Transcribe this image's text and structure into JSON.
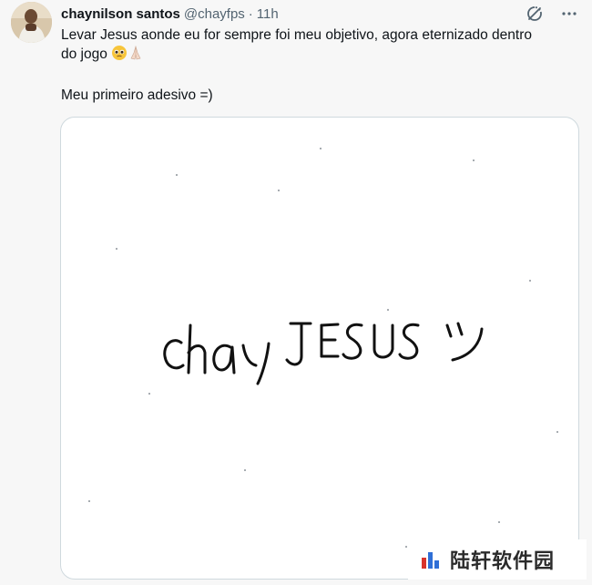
{
  "author": {
    "name": "chaynilson santos",
    "handle": "@chayfps",
    "separator": "·",
    "time": "11h"
  },
  "tweet": {
    "line1": "Levar Jesus aonde eu for sempre foi meu objetivo, agora eternizado dentro",
    "line2": "do jogo",
    "line3": "Meu primeiro adesivo =)"
  },
  "media": {
    "handwriting": "chayJESUS",
    "smiley": "ツ"
  },
  "icons": {
    "grok": "grok-icon",
    "more": "more-options-icon"
  },
  "watermark": {
    "text": "陆轩软件园"
  },
  "colors": {
    "text": "#0f1419",
    "muted": "#536471",
    "border": "#cfd9de"
  }
}
